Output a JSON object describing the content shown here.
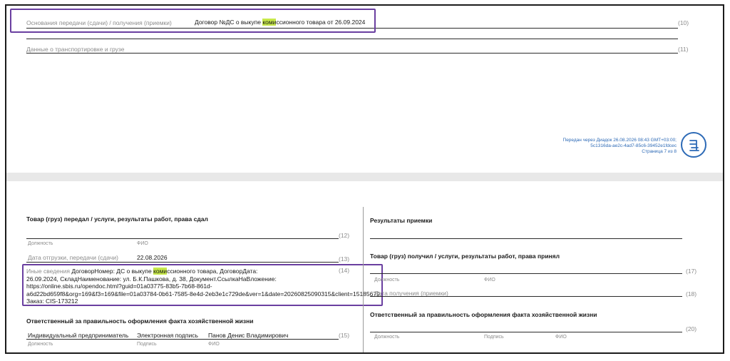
{
  "page1": {
    "row10": {
      "label": "Основания передачи (сдачи) / получения (приемки)",
      "value_pre": "Договор №ДС о выкупе ",
      "value_hl": "коми",
      "value_post": "ссионного товара от 26.09.2024",
      "num": "(10)"
    },
    "row11": {
      "label": "Данные о транспортировке и грузе",
      "num": "(11)"
    },
    "stamp": {
      "line1": "Передан через Диадок 26.08.2026 08:43 GMT+03:00;",
      "line2": "5c1316da-ae2c-4ad7-85c6-39452e1fdcec",
      "line3": "Страница 7 из 8"
    },
    "logo_icon": "diadoc-logo-icon"
  },
  "page2": {
    "left": {
      "heading": "Товар (груз) передал / услуги, результаты работ, права сдал",
      "num12": "(12)",
      "cap_position": "Должность",
      "cap_fio": "ФИО",
      "ship_date_label": "Дата отгрузки, передачи (сдачи)",
      "ship_date_value": "22.08.2026",
      "num13": "(13)",
      "other_label": "Иные сведения",
      "other_pre": "ДоговорНомер: ДС о выкупе ",
      "other_hl": "коми",
      "other_post": "ссионного товара, ДоговорДата:",
      "other_line2": "26.09.2024, СкладНаименование: ул. Б.К.Пашкова, д. 38, Документ.СсылкаНаВложение:",
      "other_line3": "https://online.sbis.ru/opendoc.html?guid=01a03775-83b5-7b68-861d-",
      "other_line4": "a6d22bd659f8&org=169&f3=169&file=01a03784-0b61-7585-8e4d-2eb3e1c729de&ver=1&date=20260825090315&client=15185679,",
      "other_line5": "Заказ: CIS-173212",
      "num14": "(14)",
      "resp_heading": "Ответственный за правильность оформления факта хозяйственной жизни",
      "resp_position": "Индивидуальный предприниматель",
      "resp_sign": "Электронная подпись",
      "resp_fio": "Панов Денис Владимирович",
      "num15": "(15)",
      "cap_sign": "Подпись"
    },
    "right": {
      "heading_results": "Результаты приемки",
      "heading_received": "Товар (груз) получил / услуги, результаты работ, права принял",
      "num17": "(17)",
      "cap_position": "Должность",
      "cap_fio": "ФИО",
      "date_label": "Дата получения (приемки)",
      "num18": "(18)",
      "resp_heading": "Ответственный за правильность оформления факта хозяйственной жизни",
      "num20": "(20)",
      "cap_sign": "Подпись"
    }
  }
}
